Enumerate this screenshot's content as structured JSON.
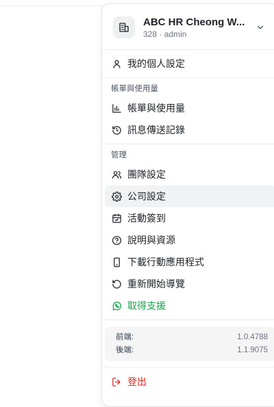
{
  "org": {
    "name": "ABC HR Cheong W...",
    "id": "328",
    "separator": "·",
    "role": "admin"
  },
  "menu": {
    "profile": "我的個人設定",
    "billing_section_title": "帳單與使用量",
    "billing": "帳單與使用量",
    "message_log": "訊息傳送記錄",
    "manage_section_title": "管理",
    "team_settings": "團隊設定",
    "company_settings": "公司設定",
    "event_checkin": "活動簽到",
    "help_resources": "說明與資源",
    "download_app": "下載行動應用程式",
    "restart_tour": "重新開始導覽",
    "get_support": "取得支援",
    "logout": "登出"
  },
  "versions": {
    "frontend_label": "前端:",
    "frontend_value": "1.0.4788",
    "backend_label": "後端:",
    "backend_value": "1.1.9075"
  },
  "colors": {
    "support_green": "#16a34a",
    "logout_red": "#dc2626",
    "active_bg": "#f1f2f4"
  },
  "icons": {
    "org": "building-icon",
    "profile": "user-icon",
    "billing": "bar-chart-icon",
    "message_log": "history-icon",
    "team": "users-icon",
    "company": "gear-icon",
    "checkin": "calendar-check-icon",
    "help": "help-circle-icon",
    "download": "smartphone-icon",
    "restart": "rotate-ccw-icon",
    "support": "whatsapp-icon",
    "logout": "log-out-icon"
  }
}
